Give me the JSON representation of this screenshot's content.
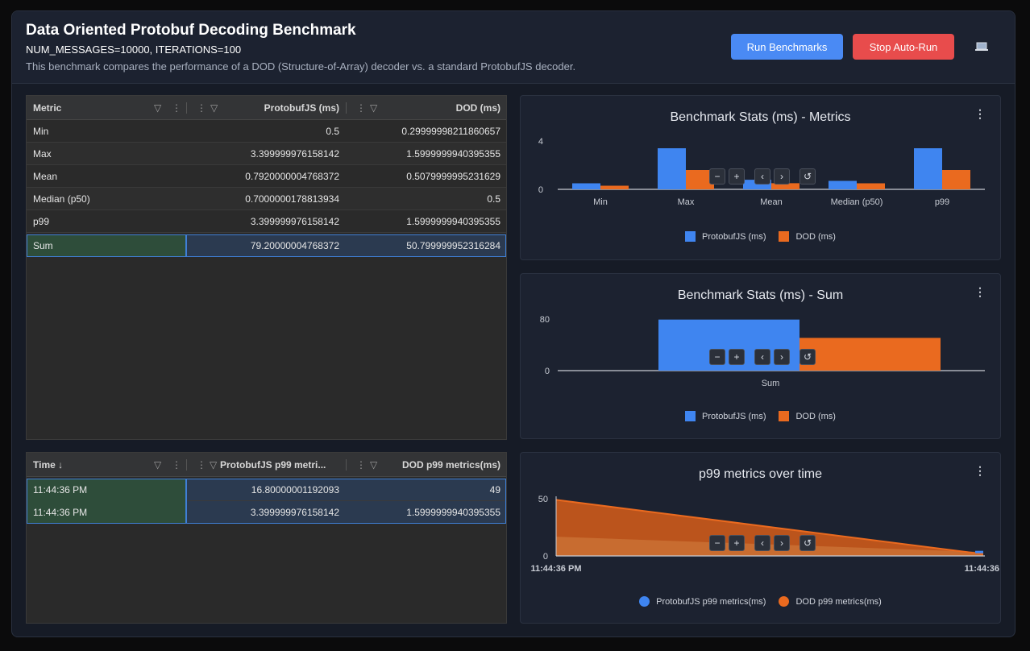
{
  "header": {
    "title": "Data Oriented Protobuf Decoding Benchmark",
    "subtitle": "NUM_MESSAGES=10000, ITERATIONS=100",
    "description": "This benchmark compares the performance of a DOD (Structure-of-Array) decoder vs. a standard ProtobufJS decoder.",
    "run_button": "Run Benchmarks",
    "stop_button": "Stop Auto-Run",
    "laptop_icon": "laptop-icon"
  },
  "stats_table": {
    "columns": [
      "Metric",
      "ProtobufJS (ms)",
      "DOD (ms)"
    ],
    "rows": [
      {
        "metric": "Min",
        "protobufjs": "0.5",
        "dod": "0.29999998211860657"
      },
      {
        "metric": "Max",
        "protobufjs": "3.399999976158142",
        "dod": "1.5999999940395355"
      },
      {
        "metric": "Mean",
        "protobufjs": "0.7920000004768372",
        "dod": "0.5079999995231629"
      },
      {
        "metric": "Median (p50)",
        "protobufjs": "0.7000000178813934",
        "dod": "0.5"
      },
      {
        "metric": "p99",
        "protobufjs": "3.399999976158142",
        "dod": "1.5999999940395355"
      },
      {
        "metric": "Sum",
        "protobufjs": "79.20000004768372",
        "dod": "50.799999952316284"
      }
    ]
  },
  "time_table": {
    "columns": [
      "Time",
      "ProtobufJS p99 metri...",
      "DOD p99 metrics(ms)"
    ],
    "sort_icon": "↓",
    "rows": [
      {
        "time": "11:44:36 PM",
        "protobufjs": "16.80000001192093",
        "dod": "49"
      },
      {
        "time": "11:44:36 PM",
        "protobufjs": "3.399999976158142",
        "dod": "1.5999999940395355"
      }
    ]
  },
  "panels": {
    "metrics_title": "Benchmark Stats (ms) - Metrics",
    "sum_title": "Benchmark Stats (ms) - Sum",
    "time_title": "p99 metrics over time",
    "kebab": "⋮"
  },
  "colors": {
    "protobufjs": "#3f85f0",
    "dod": "#ea6a1f",
    "dod_area": "#c4571b"
  },
  "chart_data": [
    {
      "type": "bar",
      "title": "Benchmark Stats (ms) - Metrics",
      "categories": [
        "Min",
        "Max",
        "Mean",
        "Median (p50)",
        "p99"
      ],
      "series": [
        {
          "name": "ProtobufJS (ms)",
          "values": [
            0.5,
            3.4,
            0.792,
            0.7,
            3.4
          ]
        },
        {
          "name": "DOD (ms)",
          "values": [
            0.3,
            1.6,
            0.508,
            0.5,
            1.6
          ]
        }
      ],
      "yticks": [
        "4",
        "0"
      ],
      "ylim": [
        0,
        4
      ],
      "legend": "bottom"
    },
    {
      "type": "bar",
      "title": "Benchmark Stats (ms) - Sum",
      "categories": [
        "Sum"
      ],
      "series": [
        {
          "name": "ProtobufJS (ms)",
          "values": [
            79.2
          ]
        },
        {
          "name": "DOD (ms)",
          "values": [
            50.8
          ]
        }
      ],
      "yticks": [
        "80",
        "0"
      ],
      "ylim": [
        0,
        80
      ],
      "legend": "bottom"
    },
    {
      "type": "area",
      "title": "p99 metrics over time",
      "x": [
        "11:44:36 PM",
        "11:44:36"
      ],
      "series": [
        {
          "name": "ProtobufJS p99 metrics(ms)",
          "values": [
            16.8,
            3.4
          ]
        },
        {
          "name": "DOD p99 metrics(ms)",
          "values": [
            49,
            1.6
          ]
        }
      ],
      "yticks": [
        "50",
        "0"
      ],
      "ylim": [
        0,
        50
      ],
      "legend": "bottom"
    }
  ]
}
